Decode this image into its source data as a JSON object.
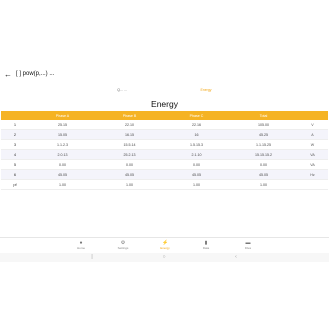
{
  "topbar": {
    "back_icon": "arrow-left-icon",
    "title": "[ ] pow(p,...) ..."
  },
  "seg_tabs": [
    "Q... ...",
    "Energy"
  ],
  "page_title": "Energy",
  "table": {
    "headers": [
      "",
      "Phase A",
      "Phase B",
      "Phase C",
      "Total",
      ""
    ],
    "rows": [
      [
        "1",
        "25.15",
        "22.10",
        "22.16",
        "105.00",
        "V"
      ],
      [
        "2",
        "15.05",
        "16.15",
        "16",
        "45.25",
        "A"
      ],
      [
        "3",
        "1.1.2.3",
        "15.5.14",
        "1.5.15.3",
        "1.1.15.25",
        "W"
      ],
      [
        "4",
        "2.0.13",
        "25.2.13",
        "2.1.10",
        "15.15.15.2",
        "VA"
      ],
      [
        "5",
        "0.00",
        "0.00",
        "0.00",
        "0.00",
        "VA"
      ],
      [
        "6",
        "45.05",
        "45.05",
        "45.05",
        "45.05",
        "Hz"
      ],
      [
        "pf",
        "1.00",
        "1.00",
        "1.00",
        "1.00",
        ""
      ]
    ]
  },
  "navbar": [
    {
      "icon": "home-icon",
      "label": "Home"
    },
    {
      "icon": "gear-icon",
      "label": "Settings"
    },
    {
      "icon": "bolt-icon",
      "label": "Energy"
    },
    {
      "icon": "document-icon",
      "label": "Data"
    },
    {
      "icon": "folder-icon",
      "label": "Files"
    }
  ],
  "system_nav": {
    "back": "back-icon",
    "home": "home-circle-icon",
    "recent": "recent-apps-icon"
  },
  "colors": {
    "accent": "#f5b324",
    "tab_active": "#f2a818",
    "row_alt": "#f4f4fb"
  }
}
